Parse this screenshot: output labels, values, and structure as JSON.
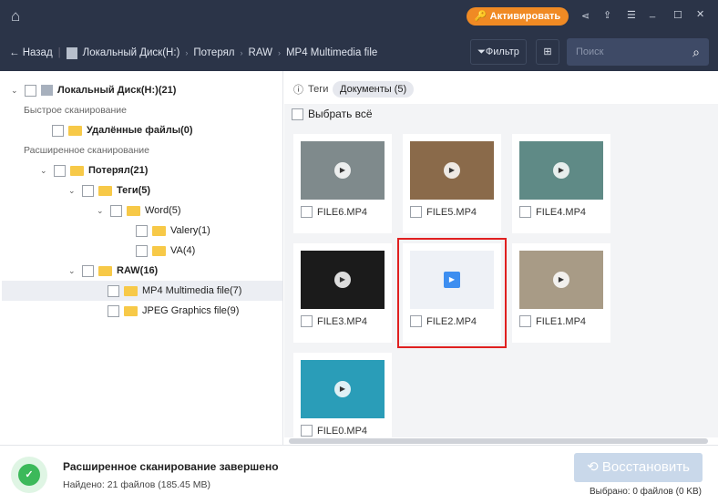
{
  "header": {
    "activate_label": "Активировать"
  },
  "nav": {
    "back_label": "Назад",
    "breadcrumb": [
      "Локальный Диск(H:)",
      "Потерял",
      "RAW",
      "MP4 Multimedia file"
    ],
    "filter_label": "Фильтр",
    "search_placeholder": "Поиск"
  },
  "tree": {
    "root": "Локальный Диск(H:)(21)",
    "quick_scan": "Быстрое сканирование",
    "deleted": "Удалённые файлы(0)",
    "deep_scan": "Расширенное сканирование",
    "lost": "Потерял(21)",
    "tags": "Теги(5)",
    "word": "Word(5)",
    "valery": "Valery(1)",
    "va": "VA(4)",
    "raw": "RAW(16)",
    "mp4": "MP4 Multimedia file(7)",
    "jpeg": "JPEG Graphics file(9)"
  },
  "tabs": {
    "tags": "Теги",
    "docs": "Документы (5)"
  },
  "select_all": "Выбрать всё",
  "files": [
    {
      "name": "FILE6.MP4",
      "color": "#7f8a8c"
    },
    {
      "name": "FILE5.MP4",
      "color": "#8a6a4a"
    },
    {
      "name": "FILE4.MP4",
      "color": "#5f8a86"
    },
    {
      "name": "FILE3.MP4",
      "color": "#1b1b1b"
    },
    {
      "name": "FILE2.MP4",
      "color": "#eef1f6"
    },
    {
      "name": "FILE1.MP4",
      "color": "#a89b86"
    },
    {
      "name": "FILE0.MP4",
      "color": "#2a9db8"
    }
  ],
  "status": {
    "title": "Расширенное сканирование завершено",
    "found": "Найдено: 21 файлов (185.45 MB)",
    "recover_label": "Восстановить",
    "selected": "Выбрано: 0 файлов  (0 KB)"
  }
}
